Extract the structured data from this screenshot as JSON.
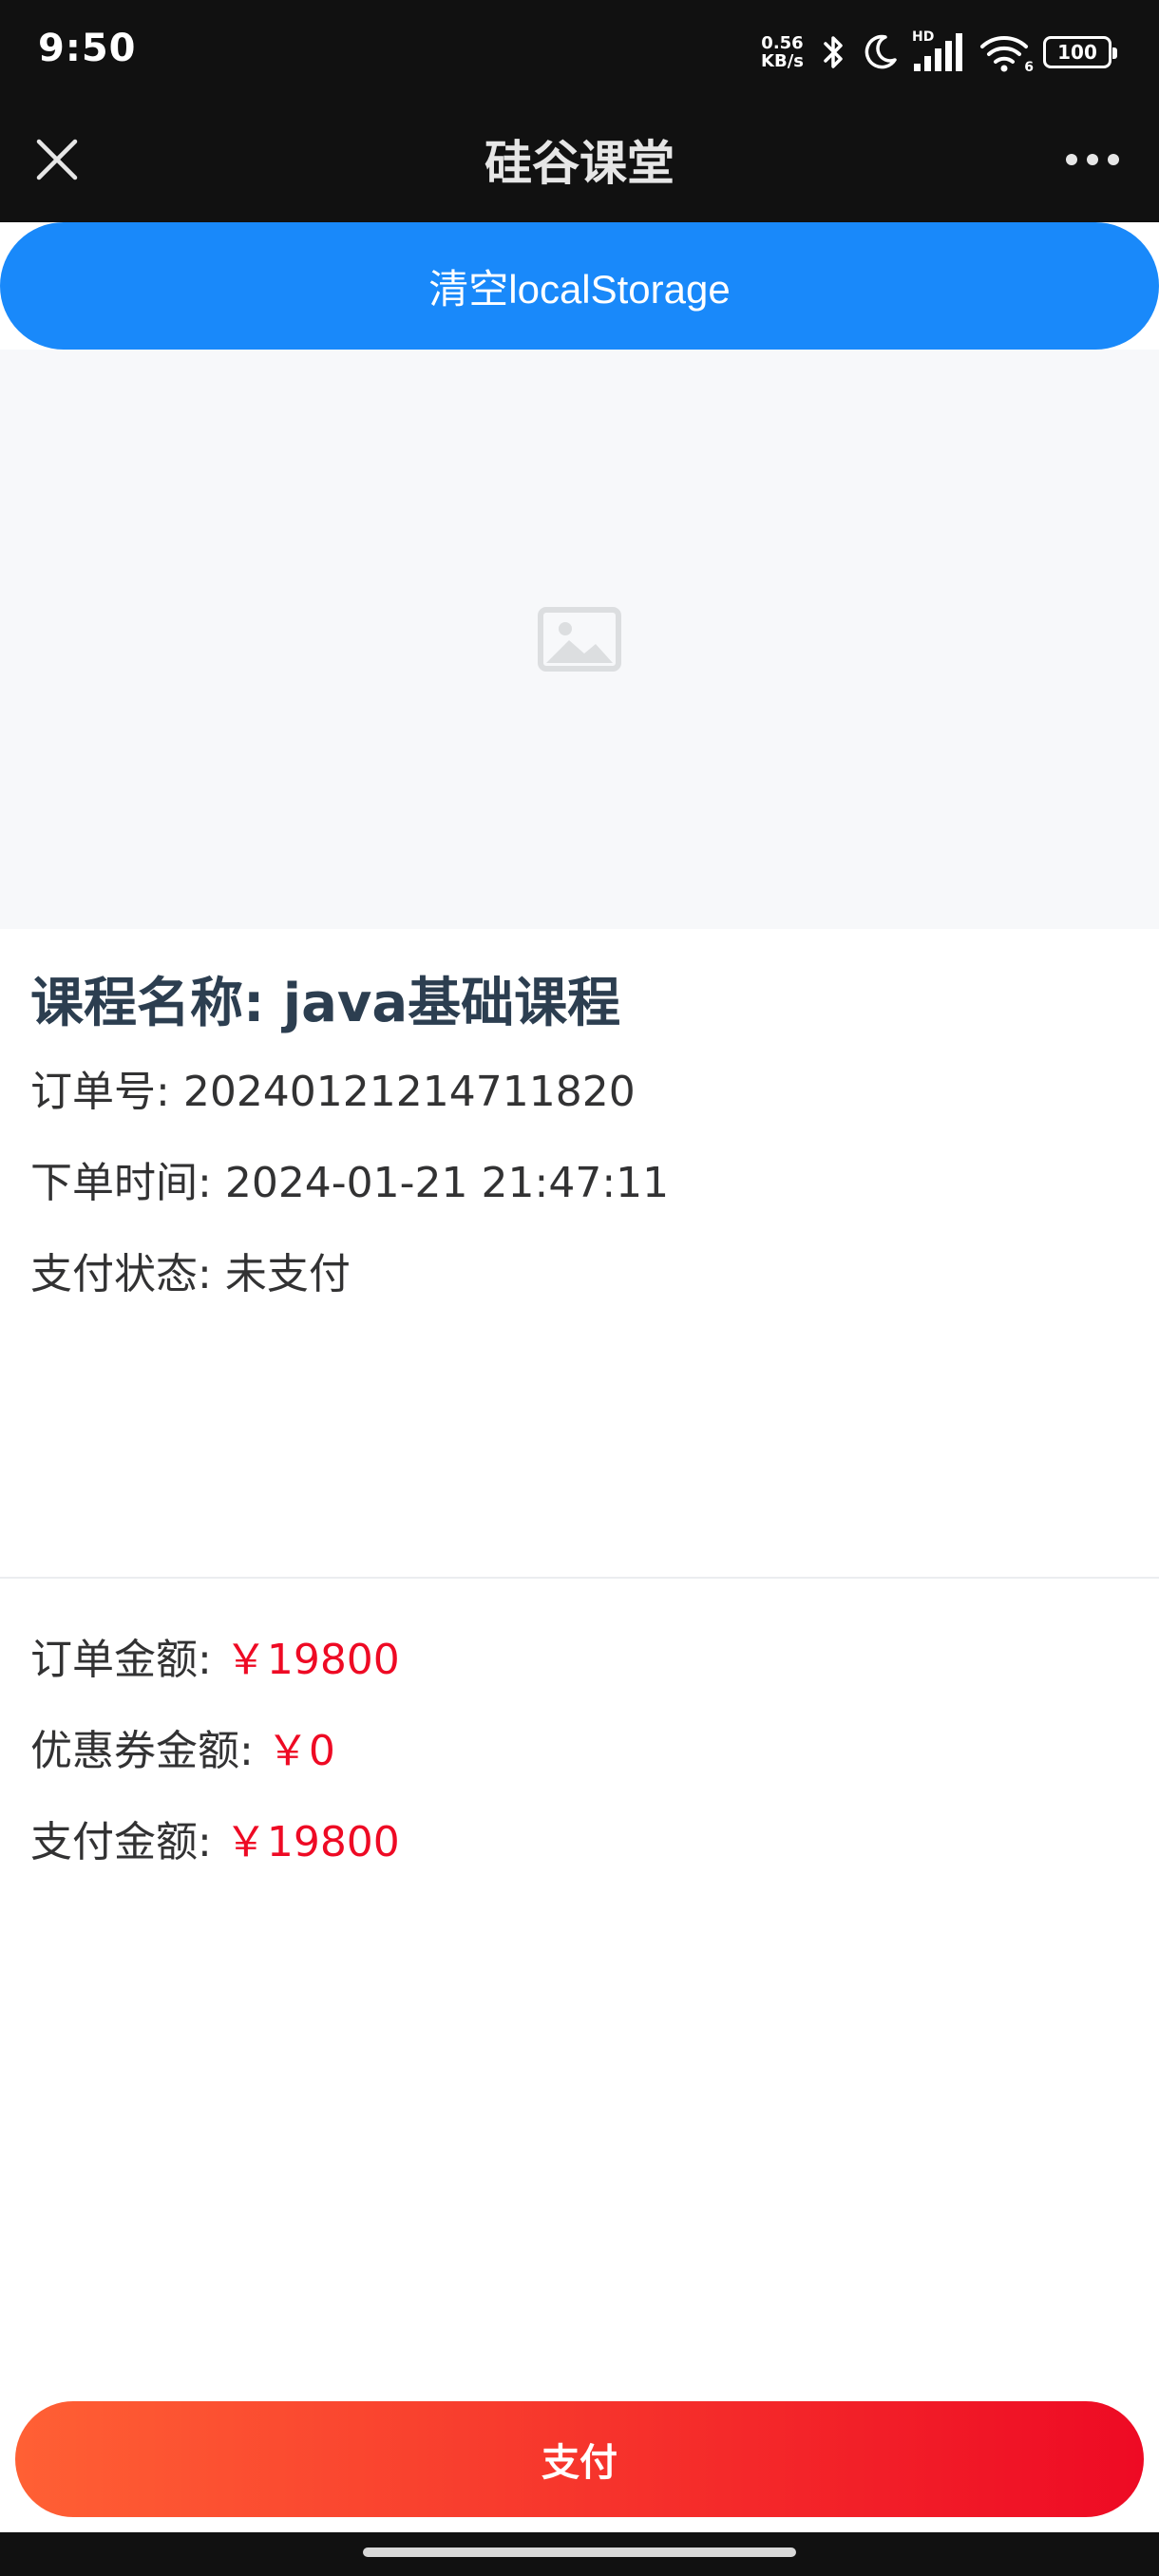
{
  "status_bar": {
    "time": "9:50",
    "net_speed_value": "0.56",
    "net_speed_unit": "KB/s",
    "signal_label": "HD",
    "wifi_label": "6",
    "battery": "100",
    "icons": [
      "bluetooth-icon",
      "moon-icon",
      "signal-icon",
      "wifi-icon",
      "battery-icon"
    ]
  },
  "nav": {
    "title": "硅谷课堂",
    "close_icon": "close-icon",
    "more_icon": "more-icon"
  },
  "actions": {
    "clear_label": "清空localStorage",
    "pay_label": "支付"
  },
  "cover": {
    "icon": "image-placeholder-icon"
  },
  "course": {
    "title": "课程名称: java基础课程"
  },
  "order": {
    "number_label": "订单号:",
    "number_value": "20240121214711820",
    "time_label": "下单时间:",
    "time_value": "2024-01-21 21:47:11",
    "status_label": "支付状态:",
    "status_value": "未支付"
  },
  "amounts": {
    "order_label": "订单金额:",
    "order_value": "￥19800",
    "coupon_label": "优惠券金额:",
    "coupon_value": "￥0",
    "pay_label": "支付金额:",
    "pay_value": "￥19800"
  },
  "colors": {
    "primary": "#1989fa",
    "price": "#ee0a24",
    "pay_gradient_start": "#ff6034",
    "pay_gradient_end": "#ee0a24"
  }
}
